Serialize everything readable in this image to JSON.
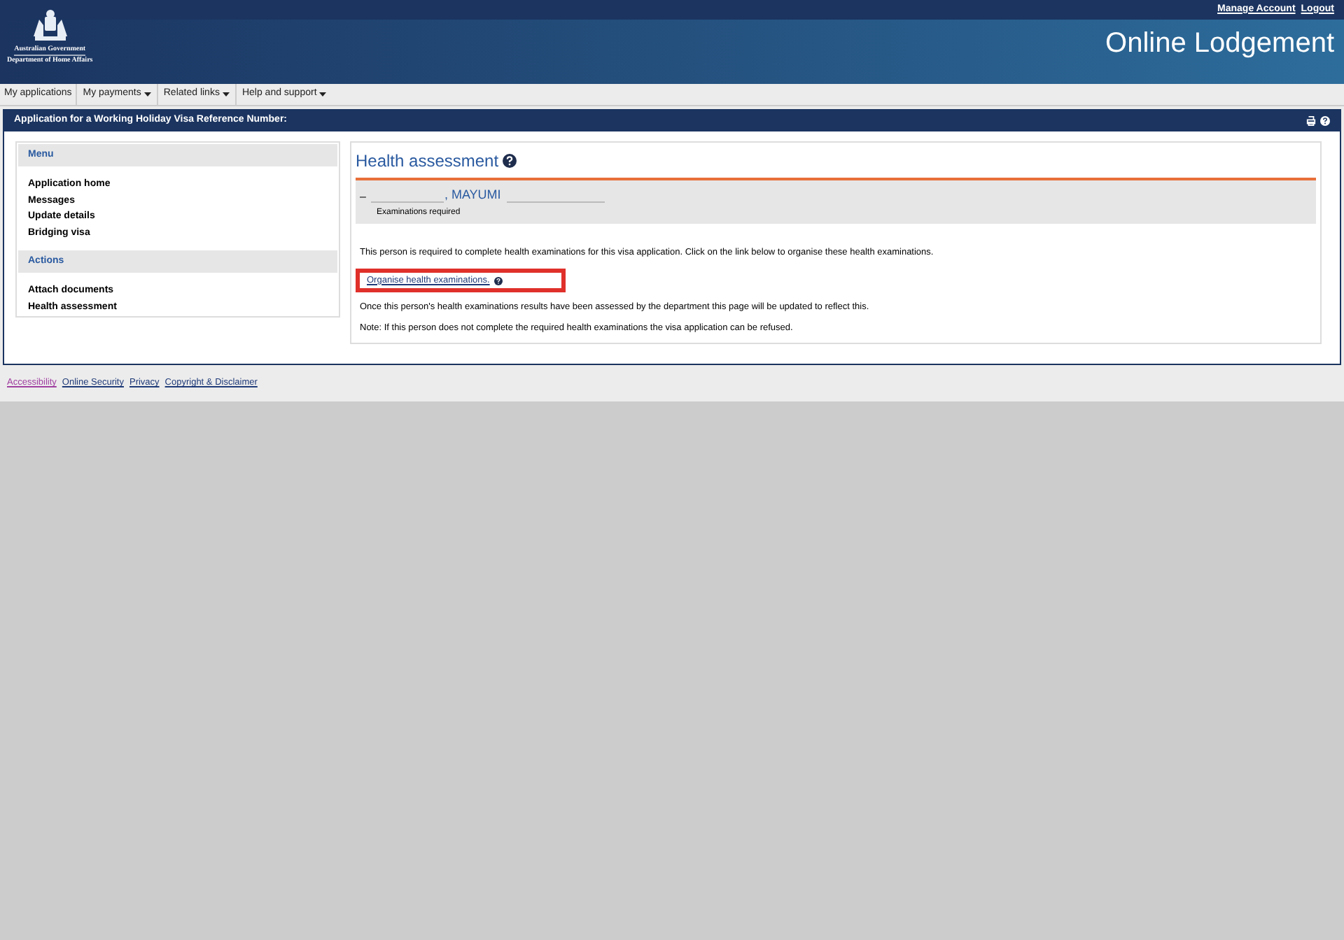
{
  "header": {
    "logo_line1": "Australian Government",
    "logo_line2": "Department of Home Affairs",
    "links": [
      "Manage Account",
      "Logout"
    ],
    "title": "Online Lodgement"
  },
  "nav": [
    {
      "label": "My applications",
      "dropdown": false
    },
    {
      "label": "My payments",
      "dropdown": true
    },
    {
      "label": "Related links",
      "dropdown": true
    },
    {
      "label": "Help and support",
      "dropdown": true
    }
  ],
  "panel": {
    "title": "Application for a Working Holiday Visa Reference Number:"
  },
  "sidebar": [
    {
      "heading": "Menu",
      "items": [
        "Application home",
        "Messages",
        "Update details",
        "Bridging visa"
      ]
    },
    {
      "heading": "Actions",
      "items": [
        "Attach documents",
        "Health assessment"
      ]
    }
  ],
  "content": {
    "title": "Health assessment",
    "applicant": {
      "prefix": "–",
      "name": ", MAYUMI",
      "status": "Examinations required"
    },
    "intro": "This person is required to complete health examinations for this visa application. Click on the link below to organise these health examinations.",
    "link": {
      "label": "Organise health examinations.",
      "highlighted": true
    },
    "paragraphs": [
      "Once this person's health examinations results have been assessed by the department this page will be updated to reflect this.",
      "Note: If this person does not complete the required health examinations the visa application can be refused."
    ]
  },
  "footer": [
    {
      "label": "Accessibility",
      "visited": true
    },
    {
      "label": "Online Security",
      "visited": false
    },
    {
      "label": "Privacy",
      "visited": false
    },
    {
      "label": "Copyright & Disclaimer",
      "visited": false
    }
  ]
}
